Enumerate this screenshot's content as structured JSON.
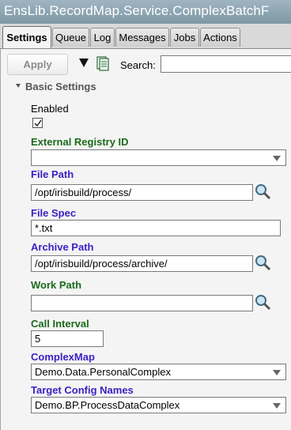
{
  "title": "EnsLib.RecordMap.Service.ComplexBatchF",
  "tabs": [
    {
      "label": "Settings",
      "active": true
    },
    {
      "label": "Queue"
    },
    {
      "label": "Log"
    },
    {
      "label": "Messages"
    },
    {
      "label": "Jobs"
    },
    {
      "label": "Actions"
    }
  ],
  "toolbar": {
    "apply_label": "Apply",
    "search_label": "Search:",
    "search_value": ""
  },
  "section": {
    "title": "Basic Settings",
    "expanded": true
  },
  "settings": {
    "enabled": {
      "label": "Enabled",
      "checked": true
    },
    "external_registry_id": {
      "label": "External Registry ID",
      "value": ""
    },
    "file_path": {
      "label": "File Path",
      "value": "/opt/irisbuild/process/"
    },
    "file_spec": {
      "label": "File Spec",
      "value": "*.txt"
    },
    "archive_path": {
      "label": "Archive Path",
      "value": "/opt/irisbuild/process/archive/"
    },
    "work_path": {
      "label": "Work Path",
      "value": ""
    },
    "call_interval": {
      "label": "Call Interval",
      "value": "5"
    },
    "complex_map": {
      "label": "ComplexMap",
      "value": "Demo.Data.PersonalComplex"
    },
    "target_config_names": {
      "label": "Target Config Names",
      "value": "Demo.BP.ProcessDataComplex"
    }
  },
  "colors": {
    "required_label": "#3a21c4",
    "optional_label": "#1a6b1a",
    "titlebar": "#8ea7b4"
  }
}
